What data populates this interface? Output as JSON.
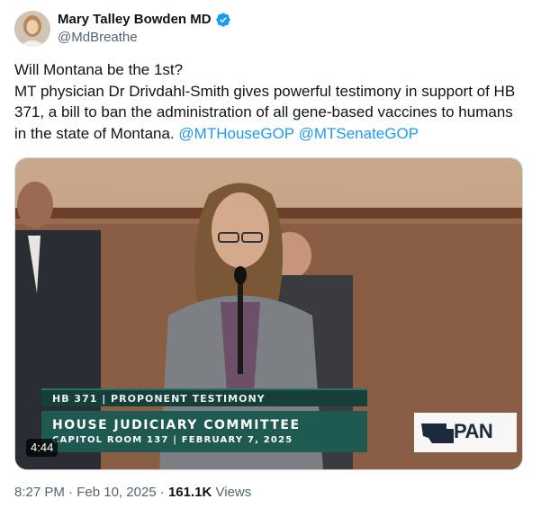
{
  "author": {
    "name": "Mary Talley Bowden MD",
    "handle": "@MdBreathe"
  },
  "tweet": {
    "line1": "Will Montana be the 1st?",
    "line2_text": "MT physician Dr Drivdahl-Smith gives powerful testimony in support of HB 371, a bill to ban the administration of all gene-based vaccines to humans in the state of Montana.",
    "mention1": "@MTHouseGOP",
    "mention2": "@MTSenateGOP"
  },
  "video": {
    "lower_third_top": "HB 371 | PROPONENT TESTIMONY",
    "lower_third_title": "HOUSE JUDICIARY COMMITTEE",
    "lower_third_sub": "CAPITOL ROOM 137 | FEBRUARY 7, 2025",
    "logo_text": "PAN",
    "duration": "4:44"
  },
  "meta": {
    "time": "8:27 PM",
    "sep1": " · ",
    "date": "Feb 10, 2025",
    "sep2": " · ",
    "views_count": "161.1K",
    "views_label": " Views"
  },
  "icons": {
    "verified": "verified-badge-icon",
    "more": "more-options-icon"
  },
  "colors": {
    "link": "#1d9bf0",
    "verified": "#1d9bf0",
    "lower_third": "#1f5a52"
  }
}
